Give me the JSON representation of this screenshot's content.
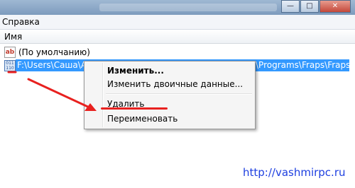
{
  "window": {
    "minimize_label": "—",
    "maximize_label": "□",
    "close_label": "✕"
  },
  "menubar": {
    "help_label": "Справка"
  },
  "list": {
    "column_name": "Имя",
    "rows": [
      {
        "icon": "string-value-icon",
        "icon_text": "ab",
        "name": "(По умолчанию)"
      },
      {
        "icon": "binary-value-icon",
        "icon_text": "011 110",
        "name": "F:\\Users\\Саша\\Ap",
        "value_tail": "\\Programs\\Fraps\\Fraps.lnk"
      }
    ]
  },
  "context_menu": {
    "items": [
      {
        "label": "Изменить..."
      },
      {
        "label": "Изменить двоичные данные..."
      },
      {
        "label": "Удалить"
      },
      {
        "label": "Переименовать"
      }
    ]
  },
  "annotations": {
    "arrow_color": "#e8211f"
  },
  "watermark": "http://vashmirpc.ru"
}
